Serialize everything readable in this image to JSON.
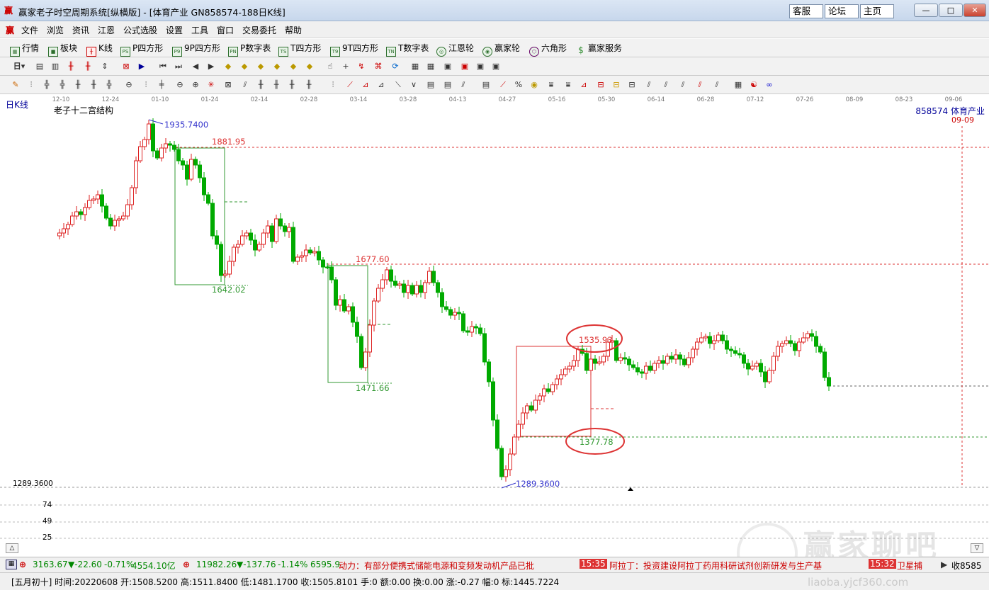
{
  "window": {
    "title": "赢家老子时空周期系统[纵横版] - [体育产业  GN858574-188日K线]",
    "btn_kefu": "客服",
    "btn_luntan": "论坛",
    "btn_home": "主页"
  },
  "menu": [
    "文件",
    "浏览",
    "资讯",
    "江恩",
    "公式选股",
    "设置",
    "工具",
    "窗口",
    "交易委托",
    "帮助"
  ],
  "toolbar1": [
    {
      "icon": "grid-icon",
      "label": "行情"
    },
    {
      "icon": "blocks-icon",
      "label": "板块"
    },
    {
      "icon": "kline-icon",
      "label": "K线"
    },
    {
      "icon": "PS",
      "label": "P四方形"
    },
    {
      "icon": "P9",
      "label": "9P四方形"
    },
    {
      "icon": "PN",
      "label": "P数字表"
    },
    {
      "icon": "TS",
      "label": "T四方形"
    },
    {
      "icon": "T9",
      "label": "9T四方形"
    },
    {
      "icon": "TN",
      "label": "T数字表"
    },
    {
      "icon": "wheel-icon",
      "label": "江恩轮"
    },
    {
      "icon": "wheel2-icon",
      "label": "赢家轮"
    },
    {
      "icon": "hexagon-icon",
      "label": "六角形"
    },
    {
      "icon": "dollar-icon",
      "label": "赢家服务"
    }
  ],
  "chart_data": {
    "type": "candlestick",
    "period_label": "日K线",
    "indicator_name": "老子十二宫结构",
    "stock_label": "858574 体育产业",
    "cursor_date": "09-09",
    "x_dates": [
      "12-10",
      "12-24",
      "01-10",
      "01-24",
      "02-14",
      "02-28",
      "03-14",
      "03-28",
      "04-13",
      "04-27",
      "05-16",
      "05-30",
      "06-14",
      "06-28",
      "07-12",
      "07-26",
      "08-09",
      "08-23",
      "09-06"
    ],
    "annotations": [
      {
        "label": "1935.7400",
        "kind": "high"
      },
      {
        "label": "1881.95",
        "kind": "level"
      },
      {
        "label": "1642.02",
        "kind": "level"
      },
      {
        "label": "1677.60",
        "kind": "level"
      },
      {
        "label": "1471.66",
        "kind": "level"
      },
      {
        "label": "1535.93",
        "kind": "level-circled"
      },
      {
        "label": "1377.78",
        "kind": "level-circled"
      },
      {
        "label": "1289.3600",
        "kind": "low"
      }
    ],
    "y_min_label": "1289.3600",
    "volume_axis": [
      "74",
      "49",
      "25"
    ]
  },
  "statusbar": {
    "sh_val": "3163.67",
    "sh_chg": "▼-22.60",
    "sh_pct": "-0.71%",
    "sh_amt": "4554.10亿",
    "sz_val": "11982.26",
    "sz_chg": "▼-137.76",
    "sz_pct": "-1.14%",
    "sz_amt": "6595.9",
    "news1": "动力：有部分便携式储能电源和变频发动机产品已批",
    "news2_time": "15:35",
    "news2": "阿拉丁：投资建设阿拉丁药用科研试剂创新研发与生产基",
    "news3_time": "15:32",
    "news3": "卫星捕",
    "tail": "收8585"
  },
  "bottom": "[五月初十] 时间:20220608 开:1508.5200 高:1511.8400 低:1481.1700 收:1505.8101 手:0 额:0.00 换:0.00 涨:-0.27 幅:0 标:1445.7224",
  "watermark": "赢家聊吧",
  "watermark_url": "liaoba.yjcf360.com"
}
